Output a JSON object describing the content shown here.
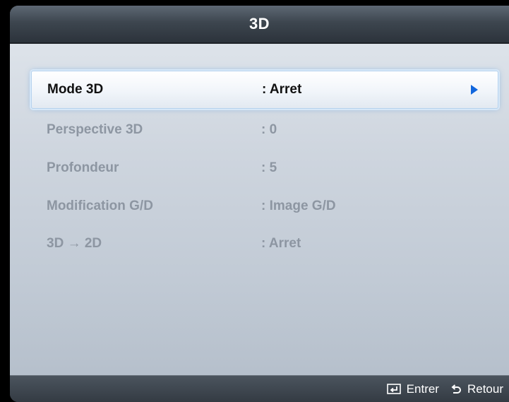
{
  "header": {
    "title": "3D"
  },
  "menu": {
    "items": [
      {
        "label": "Mode 3D",
        "value": ": Arret",
        "state": "selected"
      },
      {
        "label": "Perspective 3D",
        "value": ": 0",
        "state": "disabled"
      },
      {
        "label": "Profondeur",
        "value": ": 5",
        "state": "disabled"
      },
      {
        "label": "Modification G/D",
        "value": ": Image G/D",
        "state": "disabled"
      },
      {
        "label": "3D → 2D",
        "value": ": Arret",
        "state": "disabled"
      }
    ]
  },
  "footer": {
    "enter_label": "Entrer",
    "return_label": "Retour"
  },
  "colors": {
    "accent_arrow": "#1166dd",
    "disabled_text": "#8d96a2",
    "selected_glow": "#d7e8f8"
  },
  "icons": [
    "chevron-right-icon",
    "enter-icon",
    "return-icon"
  ]
}
